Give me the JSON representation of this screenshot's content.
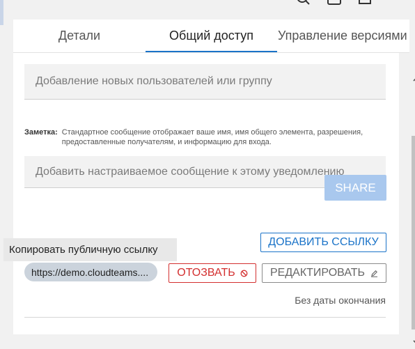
{
  "tabs": [
    {
      "label": "Детали"
    },
    {
      "label": "Общий доступ"
    },
    {
      "label": "Управление версиями"
    }
  ],
  "share_form": {
    "users_placeholder": "Добавление новых пользователей или группу",
    "note_label": "Заметка:",
    "note_text": "Стандартное сообщение отображает ваше имя, имя общего элемента, разрешения, предоставленные получателям, и информацию для входа.",
    "message_placeholder": "Добавить настраиваемое сообщение к этому уведомлению",
    "share_label": "SHARE"
  },
  "public_link": {
    "add_link_label": "ДОБАВИТЬ ССЫЛКУ",
    "url": "https://demo.cloudteams....",
    "revoke_label": "ОТОЗВАТЬ",
    "edit_label": "РЕДАКТИРОВАТЬ",
    "expiry": "Без даты окончания",
    "tooltip": "Копировать публичную ссылку"
  },
  "colors": {
    "accent": "#1a73c8",
    "danger": "#d32f2f",
    "share_disabled": "#a9c8ee"
  }
}
